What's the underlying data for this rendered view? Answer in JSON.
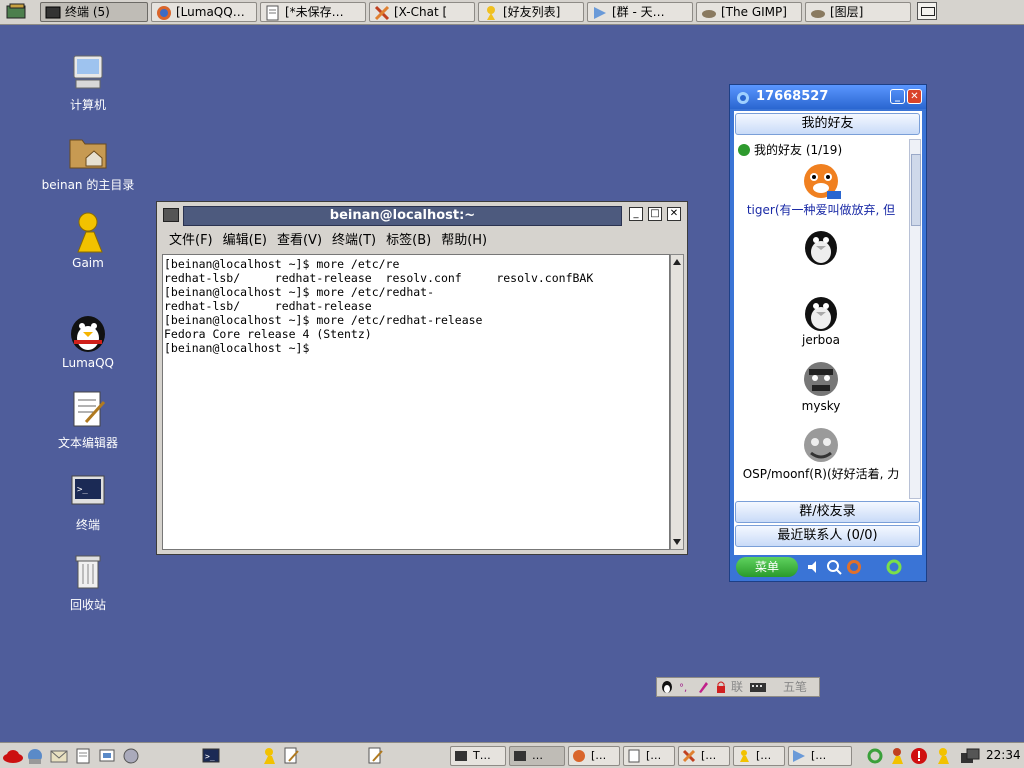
{
  "top_panel": {
    "tasks": [
      {
        "label": "终端 (5)",
        "icon": "terminal-icon"
      },
      {
        "label": "[LumaQQ…",
        "icon": "firefox-icon"
      },
      {
        "label": "[*未保存…",
        "icon": "text-editor-icon"
      },
      {
        "label": "[X-Chat [",
        "icon": "xchat-icon"
      },
      {
        "label": "[好友列表]",
        "icon": "gaim-icon"
      },
      {
        "label": "[群 - 天…",
        "icon": "qq-group-icon"
      },
      {
        "label": "[The GIMP]",
        "icon": "gimp-icon"
      },
      {
        "label": "[图层]",
        "icon": "gimp-layers-icon"
      }
    ]
  },
  "desktop_icons": [
    {
      "label": "计算机",
      "icon": "computer-icon"
    },
    {
      "label": "beinan 的主目录",
      "icon": "home-folder-icon"
    },
    {
      "label": "Gaim",
      "icon": "gaim-icon"
    },
    {
      "label": "LumaQQ",
      "icon": "qq-penguin-icon"
    },
    {
      "label": "文本编辑器",
      "icon": "text-editor-icon"
    },
    {
      "label": "终端",
      "icon": "terminal-icon"
    },
    {
      "label": "回收站",
      "icon": "trash-icon"
    }
  ],
  "terminal": {
    "title": "beinan@localhost:~",
    "menu": [
      "文件(F)",
      "编辑(E)",
      "查看(V)",
      "终端(T)",
      "标签(B)",
      "帮助(H)"
    ],
    "output": "[beinan@localhost ~]$ more /etc/re\nredhat-lsb/     redhat-release  resolv.conf     resolv.confBAK\n[beinan@localhost ~]$ more /etc/redhat-\nredhat-lsb/     redhat-release\n[beinan@localhost ~]$ more /etc/redhat-release\nFedora Core release 4 (Stentz)\n[beinan@localhost ~]$"
  },
  "qq": {
    "qq_number": "17668527",
    "tab_friends": "我的好友",
    "group_title": "我的好友 (1/19)",
    "friends": [
      {
        "name": "tiger(有一种爱叫做放弃, 但",
        "avatar": "tiger-avatar-icon"
      },
      {
        "name": "",
        "avatar": "penguin-avatar-icon"
      },
      {
        "name": "jerboa",
        "avatar": "penguin-avatar-icon"
      },
      {
        "name": "mysky",
        "avatar": "angry-man-avatar-icon"
      },
      {
        "name": "OSP/moonf(R)(好好活着, 力",
        "avatar": "monster-avatar-icon"
      }
    ],
    "tab_groups": "群/校友录",
    "tab_recent": "最近联系人 (0/0)",
    "menu_button": "菜单"
  },
  "ime": {
    "items": [
      "联",
      "五笔"
    ]
  },
  "bottom_panel": {
    "tasks": [
      {
        "label": "T…",
        "icon": "terminal-icon"
      },
      {
        "label": "…",
        "icon": "terminal-icon"
      },
      {
        "label": "[…",
        "icon": "firefox-icon"
      },
      {
        "label": "[…",
        "icon": "text-editor-icon"
      },
      {
        "label": "[…",
        "icon": "xchat-icon"
      },
      {
        "label": "[…",
        "icon": "gaim-icon"
      },
      {
        "label": "[…",
        "icon": "qq-group-icon"
      }
    ],
    "clock": "22:34"
  }
}
